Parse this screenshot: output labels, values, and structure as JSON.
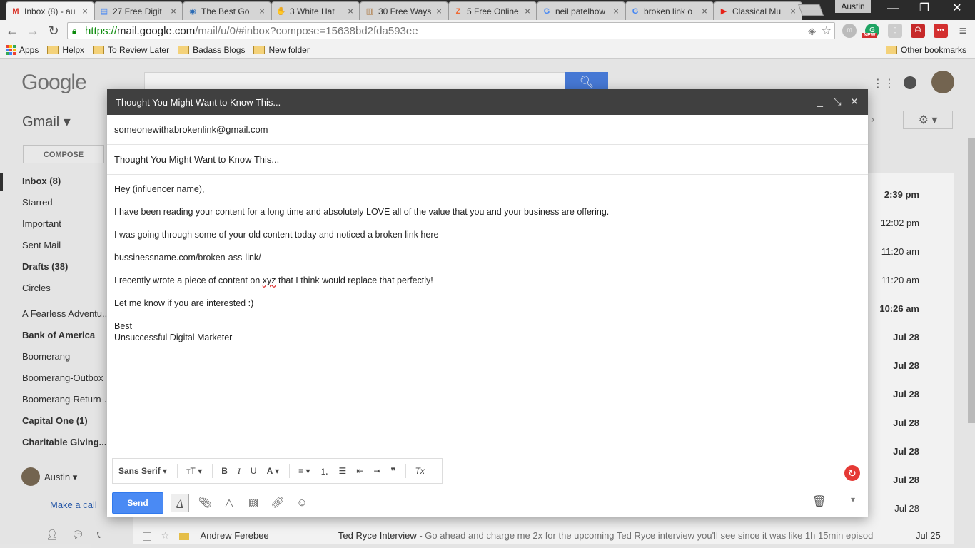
{
  "browser": {
    "tabs": [
      {
        "title": "Inbox (8) - au",
        "icon": "gmail-icon",
        "icon_color": "#d93025",
        "glyph": "M"
      },
      {
        "title": "27 Free Digit",
        "icon": "docs-icon",
        "icon_color": "#4285f4",
        "glyph": "▤"
      },
      {
        "title": "The Best Go",
        "icon": "search-doc-icon",
        "icon_color": "#2a6bb5",
        "glyph": "◉"
      },
      {
        "title": "3 White Hat",
        "icon": "hand-icon",
        "icon_color": "#3b6db3",
        "glyph": "✋"
      },
      {
        "title": "30 Free Ways",
        "icon": "books-icon",
        "icon_color": "#a86a2c",
        "glyph": "▥"
      },
      {
        "title": "5 Free Online",
        "icon": "z-icon",
        "icon_color": "#f06a35",
        "glyph": "Z"
      },
      {
        "title": "neil patelhow",
        "icon": "google-icon",
        "icon_color": "#4285f4",
        "glyph": "G"
      },
      {
        "title": "broken link o",
        "icon": "google-icon",
        "icon_color": "#4285f4",
        "glyph": "G"
      },
      {
        "title": "Classical Mu",
        "icon": "youtube-icon",
        "icon_color": "#e62117",
        "glyph": "▶"
      }
    ],
    "profile_name": "Austin",
    "window_controls": {
      "minimize": "—",
      "restore": "❐",
      "close": "✕"
    },
    "url": {
      "scheme": "https://",
      "host": "mail.google.com",
      "path": "/mail/u/0/#inbox?compose=15638bd2fda593ee"
    },
    "bookmarks": [
      {
        "label": "Apps",
        "type": "apps"
      },
      {
        "label": "Helpx",
        "type": "folder"
      },
      {
        "label": "To Review Later",
        "type": "folder"
      },
      {
        "label": "Badass Blogs",
        "type": "folder"
      },
      {
        "label": "New folder",
        "type": "folder"
      }
    ],
    "other_bookmarks": "Other bookmarks",
    "ext_new_badge": "NEW"
  },
  "gmail": {
    "logo": "Google",
    "app_label": "Gmail ▾",
    "compose_label": "COMPOSE",
    "nav": [
      {
        "label": "Inbox (8)",
        "bold": true
      },
      {
        "label": "Starred",
        "bold": false
      },
      {
        "label": "Important",
        "bold": false
      },
      {
        "label": "Sent Mail",
        "bold": false
      },
      {
        "label": "Drafts (38)",
        "bold": true
      },
      {
        "label": "Circles",
        "bold": false
      },
      {
        "label": "A Fearless Adventu...",
        "bold": false
      },
      {
        "label": "Bank of America",
        "bold": true
      },
      {
        "label": "Boomerang",
        "bold": false
      },
      {
        "label": "Boomerang-Outbox",
        "bold": false
      },
      {
        "label": "Boomerang-Return-...",
        "bold": false
      },
      {
        "label": "Capital One (1)",
        "bold": true
      },
      {
        "label": "Charitable Giving...",
        "bold": true
      }
    ],
    "user": "Austin ▾",
    "make_call": "Make a call",
    "times": [
      {
        "t": "2:39 pm",
        "bold": true
      },
      {
        "t": "12:02 pm",
        "bold": false
      },
      {
        "t": "11:20 am",
        "bold": false
      },
      {
        "t": "11:20 am",
        "bold": false
      },
      {
        "t": "10:26 am",
        "bold": true
      },
      {
        "t": "Jul 28",
        "bold": true
      },
      {
        "t": "Jul 28",
        "bold": true
      },
      {
        "t": "Jul 28",
        "bold": true
      },
      {
        "t": "Jul 28",
        "bold": true
      },
      {
        "t": "Jul 28",
        "bold": true
      },
      {
        "t": "Jul 28",
        "bold": true
      },
      {
        "t": "Jul 28",
        "bold": false
      }
    ],
    "bottom_row": {
      "sender": "Andrew Ferebee",
      "subject": "Ted Ryce Interview",
      "snippet": " - Go ahead and charge me 2x for the upcoming Ted Ryce interview you'll see since it was like 1h 15min episod",
      "date": "Jul 25"
    }
  },
  "compose": {
    "title": "Thought You Might Want to Know This...",
    "to": "someonewithabrokenlink@gmail.com",
    "subject": "Thought You Might Want to Know This...",
    "body": {
      "greeting": "Hey (influencer name),",
      "p1": "I have been reading your content for a long time and absolutely LOVE all of the value that you and your business are offering.",
      "p2": "I was going through some of your old content today and noticed a broken link here",
      "p3": "bussinessname.com/broken-ass-link/",
      "p4_before": "I recently wrote a piece of content on ",
      "p4_word": "xyz",
      "p4_after": " that I think would replace that perfectly!",
      "p5": "Let me know if you are interested :)",
      "sign1": "Best",
      "sign2": "Unsuccessful Digital Marketer"
    },
    "font_select": "Sans Serif",
    "send_label": "Send"
  }
}
